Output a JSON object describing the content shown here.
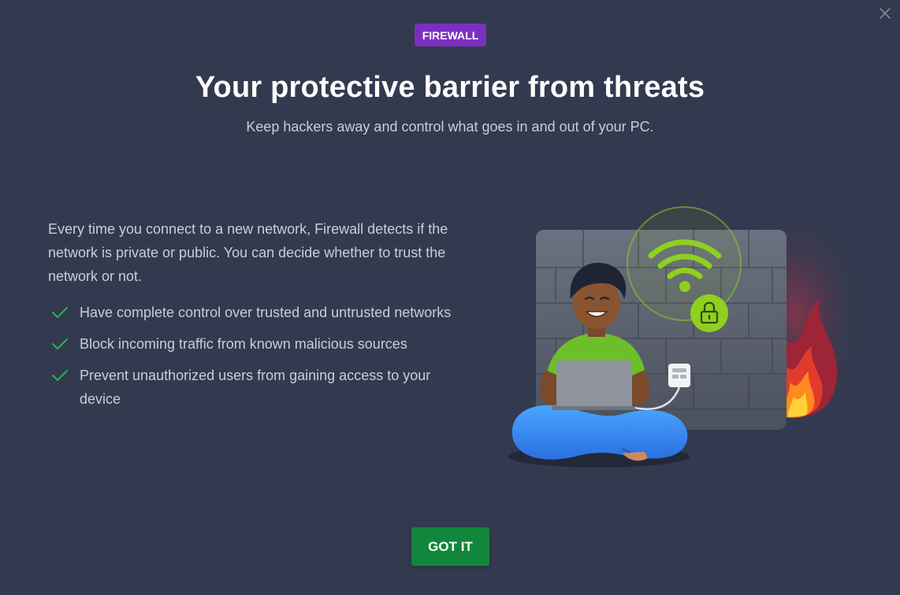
{
  "badge": {
    "label": "FIREWALL",
    "color": "#7b2fbf"
  },
  "header": {
    "title": "Your protective barrier from threats",
    "subtitle": "Keep hackers away and control what goes in and out of your PC."
  },
  "intro": "Every time you connect to a new network, Firewall detects if the network is private or public. You can decide whether to trust the network or not.",
  "features": [
    {
      "icon": "check-icon",
      "text": "Have complete control over trusted and untrusted networks"
    },
    {
      "icon": "check-icon",
      "text": "Block incoming traffic from known malicious sources"
    },
    {
      "icon": "check-icon",
      "text": "Prevent unauthorized users from gaining access to your device"
    }
  ],
  "actions": {
    "got_it_label": "GOT IT",
    "got_it_color": "#12873c"
  },
  "colors": {
    "background": "#333a4f",
    "accent_green": "#8fd01f",
    "check_green": "#2bb24c"
  }
}
